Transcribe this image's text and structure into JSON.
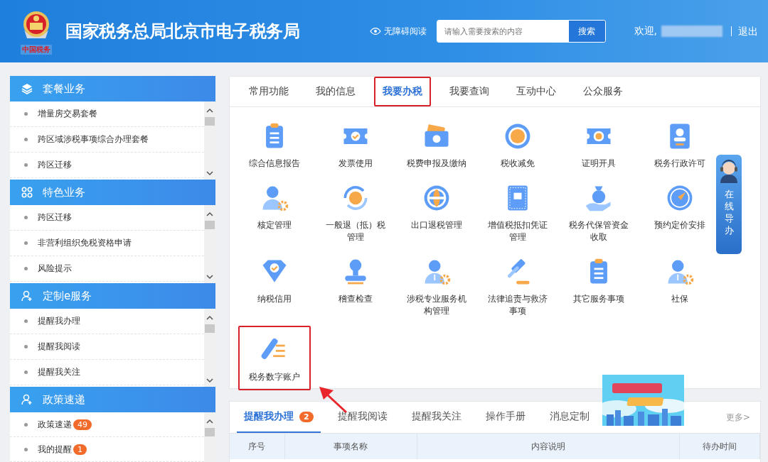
{
  "header": {
    "logo_caption": "中国税务",
    "title": "国家税务总局北京市电子税务局",
    "accessibility_link": "无障碍阅读",
    "search": {
      "placeholder": "请输入需要搜索的内容",
      "button": "搜索"
    },
    "greeting": "欢迎,",
    "logout": "退出"
  },
  "sidebar": {
    "sections": [
      {
        "title": "套餐业务",
        "items": [
          {
            "label": "增量房交易套餐"
          },
          {
            "label": "跨区域涉税事项综合办理套餐"
          },
          {
            "label": "跨区迁移"
          }
        ]
      },
      {
        "title": "特色业务",
        "items": [
          {
            "label": "跨区迁移"
          },
          {
            "label": "非营利组织免税资格申请"
          },
          {
            "label": "风险提示"
          }
        ]
      },
      {
        "title": "定制e服务",
        "items": [
          {
            "label": "提醒我办理"
          },
          {
            "label": "提醒我阅读"
          },
          {
            "label": "提醒我关注"
          }
        ]
      },
      {
        "title": "政策速递",
        "items": [
          {
            "label": "政策速递",
            "badge": "49"
          },
          {
            "label": "我的提醒",
            "badge": "1"
          }
        ]
      }
    ]
  },
  "main_tabs": [
    {
      "label": "常用功能",
      "selected": false,
      "highlighted": false
    },
    {
      "label": "我的信息",
      "selected": false,
      "highlighted": false
    },
    {
      "label": "我要办税",
      "selected": true,
      "highlighted": true
    },
    {
      "label": "我要查询",
      "selected": false,
      "highlighted": false
    },
    {
      "label": "互动中心",
      "selected": false,
      "highlighted": false
    },
    {
      "label": "公众服务",
      "selected": false,
      "highlighted": false
    }
  ],
  "services": [
    {
      "label": "综合信息报告",
      "highlighted": false
    },
    {
      "label": "发票使用",
      "highlighted": false
    },
    {
      "label": "税费申报及缴纳",
      "highlighted": false
    },
    {
      "label": "税收减免",
      "highlighted": false
    },
    {
      "label": "证明开具",
      "highlighted": false
    },
    {
      "label": "税务行政许可",
      "highlighted": false
    },
    {
      "label": "核定管理",
      "highlighted": false
    },
    {
      "label": "一般退（抵）税管理",
      "highlighted": false
    },
    {
      "label": "出口退税管理",
      "highlighted": false
    },
    {
      "label": "增值税抵扣凭证管理",
      "highlighted": false
    },
    {
      "label": "税务代保管资金收取",
      "highlighted": false
    },
    {
      "label": "预约定价安排",
      "highlighted": false
    },
    {
      "label": "纳税信用",
      "highlighted": false
    },
    {
      "label": "稽查检查",
      "highlighted": false
    },
    {
      "label": "涉税专业服务机构管理",
      "highlighted": false
    },
    {
      "label": "法律追责与救济事项",
      "highlighted": false
    },
    {
      "label": "其它服务事项",
      "highlighted": false
    },
    {
      "label": "社保",
      "highlighted": false
    },
    {
      "label": "税务数字账户",
      "highlighted": true
    }
  ],
  "guide_widget": {
    "label": "在线导办"
  },
  "reminder_tabs": [
    {
      "label": "提醒我办理",
      "selected": true,
      "badge": "2"
    },
    {
      "label": "提醒我阅读",
      "selected": false
    },
    {
      "label": "提醒我关注",
      "selected": false
    },
    {
      "label": "操作手册",
      "selected": false
    },
    {
      "label": "消息定制",
      "selected": false
    }
  ],
  "more_link": "更多>",
  "table": {
    "columns": [
      "序号",
      "事项名称",
      "内容说明",
      "待办时间"
    ]
  }
}
